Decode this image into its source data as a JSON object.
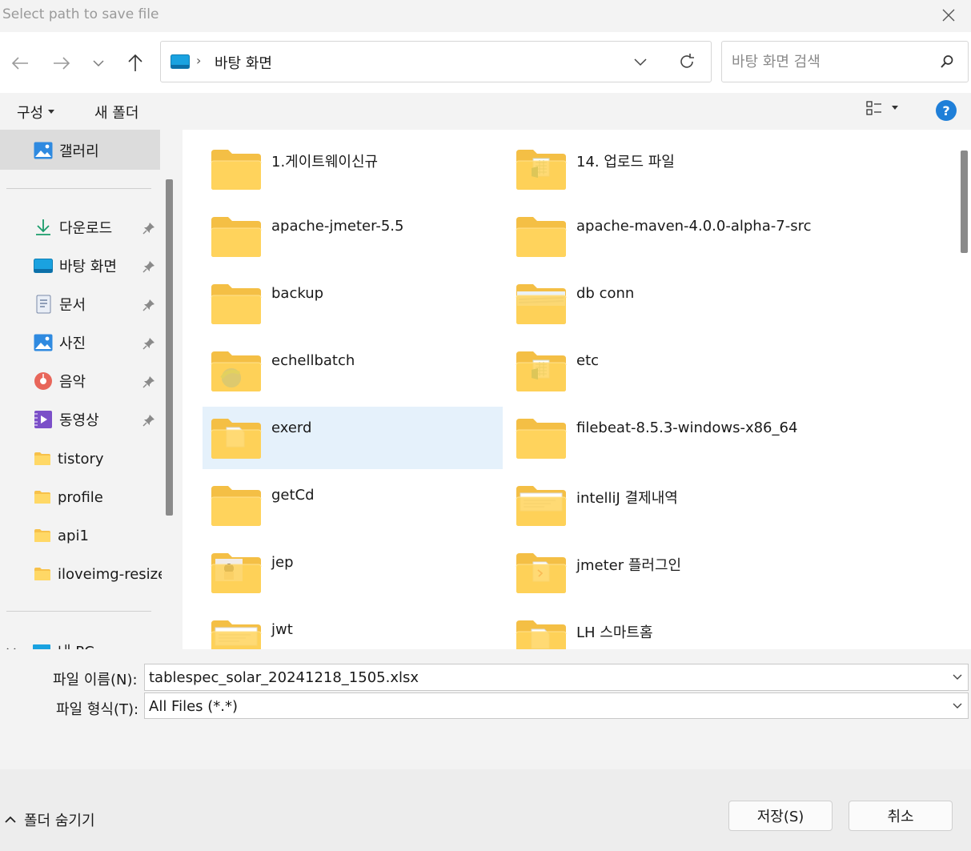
{
  "window": {
    "title": "Select path to save file"
  },
  "address": {
    "location": "바탕 화면",
    "separator": "›"
  },
  "search": {
    "placeholder": "바탕 화면 검색"
  },
  "commands": {
    "organize": "구성",
    "new_folder": "새 폴더",
    "help": "?"
  },
  "sidebar": {
    "gallery": "갤러리",
    "quick_access": [
      {
        "label": "다운로드",
        "icon": "download-icon",
        "pinned": true
      },
      {
        "label": "바탕 화면",
        "icon": "desktop-icon",
        "pinned": true
      },
      {
        "label": "문서",
        "icon": "document-icon",
        "pinned": true
      },
      {
        "label": "사진",
        "icon": "pictures-icon",
        "pinned": true
      },
      {
        "label": "음악",
        "icon": "music-icon",
        "pinned": true
      },
      {
        "label": "동영상",
        "icon": "video-icon",
        "pinned": true
      },
      {
        "label": "tistory",
        "icon": "folder-icon",
        "pinned": false
      },
      {
        "label": "profile",
        "icon": "folder-icon",
        "pinned": false
      },
      {
        "label": "api1",
        "icon": "folder-icon",
        "pinned": false
      },
      {
        "label": "iloveimg-resized",
        "icon": "folder-icon",
        "pinned": false
      }
    ],
    "this_pc": "내 PC"
  },
  "folders": [
    {
      "name": "1.게이트웨이신규",
      "preview": "none"
    },
    {
      "name": "14. 업로드 파일",
      "preview": "excel"
    },
    {
      "name": "apache-jmeter-5.5",
      "preview": "none"
    },
    {
      "name": "apache-maven-4.0.0-alpha-7-src",
      "preview": "none"
    },
    {
      "name": "backup",
      "preview": "none"
    },
    {
      "name": "db conn",
      "preview": "image"
    },
    {
      "name": "echellbatch",
      "preview": "edge"
    },
    {
      "name": "etc",
      "preview": "excel"
    },
    {
      "name": "exerd",
      "preview": "doc",
      "selected": true
    },
    {
      "name": "filebeat-8.5.3-windows-x86_64",
      "preview": "none"
    },
    {
      "name": "getCd",
      "preview": "none"
    },
    {
      "name": "intelliJ 결제내역",
      "preview": "paper"
    },
    {
      "name": "jep",
      "preview": "photo"
    },
    {
      "name": "jmeter 플러그인",
      "preview": "doc-red"
    },
    {
      "name": "jwt",
      "preview": "paper"
    },
    {
      "name": "LH 스마트홈",
      "preview": "doc"
    }
  ],
  "file_name": {
    "label": "파일 이름(N):",
    "value": "tablespec_solar_20241218_1505.xlsx"
  },
  "file_type": {
    "label": "파일 형식(T):",
    "value": "All Files (*.*)"
  },
  "footer": {
    "hide_folders": "폴더 숨기기",
    "save": "저장(S)",
    "cancel": "취소"
  },
  "colors": {
    "accent": "#1f7fd8",
    "folder": "#ffd35c",
    "selection": "#e5f1fb"
  }
}
